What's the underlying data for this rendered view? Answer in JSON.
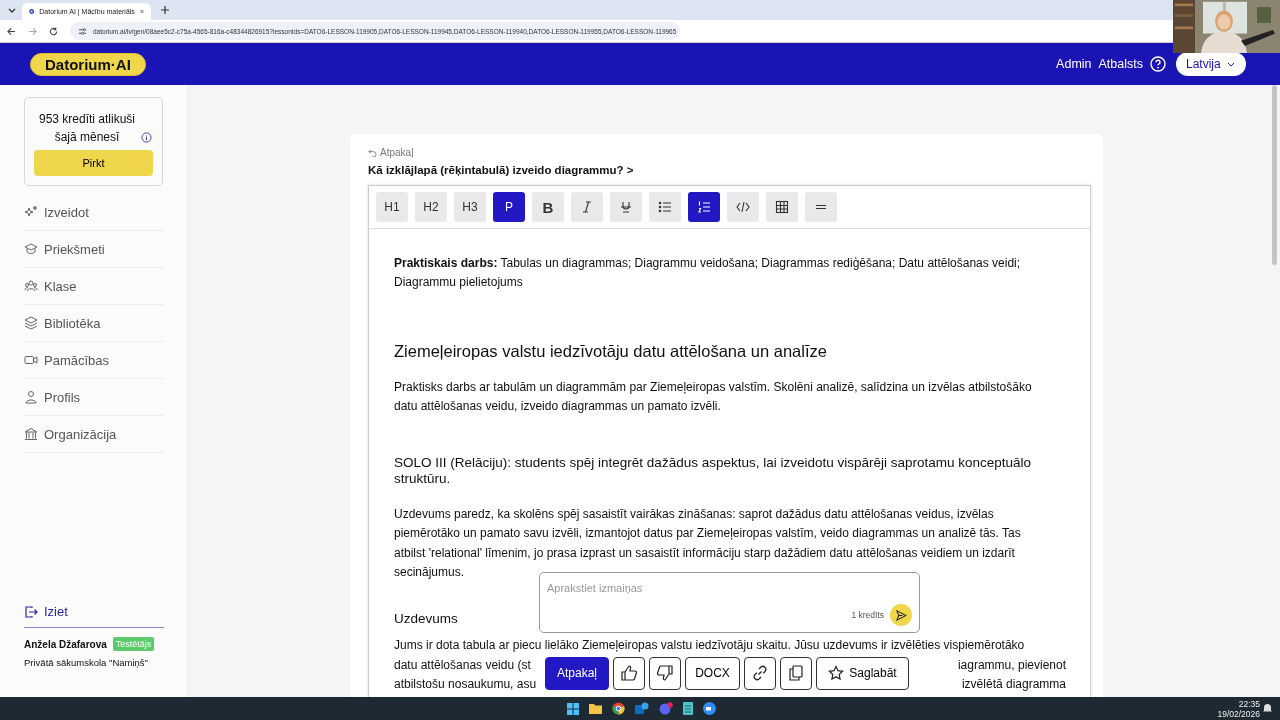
{
  "browser": {
    "tab_title": "Datorium AI | Mācību materiāls",
    "url": "datorium.ai/lv/gen/08aee5c2-c75a-4565-816a-c48344826915?lessonIds=DATO6-LESSON-119905,DATO6-LESSON-119945,DATO6-LESSON-119940,DATO6-LESSON-119955,DATO6-LESSON-119965"
  },
  "header": {
    "logo": "Datorium·AI",
    "links": [
      "Admin",
      "Atbalsts"
    ],
    "language": "Latvija"
  },
  "sidebar": {
    "credits": "953 kredīti atlikuši šajā mēnesī",
    "buy_button": "Pirkt",
    "items": [
      {
        "kind": "create",
        "label": "Izveidot"
      },
      {
        "kind": "subjects",
        "label": "Priekšmeti"
      },
      {
        "kind": "class",
        "label": "Klase"
      },
      {
        "kind": "library",
        "label": "Bibliotēka"
      },
      {
        "kind": "tutorials",
        "label": "Pamācības"
      },
      {
        "kind": "profile",
        "label": "Profils"
      },
      {
        "kind": "organization",
        "label": "Organizācija"
      }
    ],
    "logout": "Iziet",
    "user": {
      "name": "Anžela Džafarova",
      "badge": "Testētājs",
      "school": "Privātā sākumskola \"Namiņš\""
    }
  },
  "editor": {
    "back": "Atpakaļ",
    "breadcrumb": "Kā izklājlapā (rēķintabulā) izveido diagrammu? >",
    "toolbar": [
      {
        "kind": "text",
        "label": "H1",
        "selected": false
      },
      {
        "kind": "text",
        "label": "H2",
        "selected": false
      },
      {
        "kind": "text",
        "label": "H3",
        "selected": false
      },
      {
        "kind": "text",
        "label": "P",
        "selected": true
      },
      {
        "kind": "bold",
        "label": "B",
        "selected": false
      },
      {
        "kind": "italic",
        "selected": false
      },
      {
        "kind": "strike",
        "selected": false
      },
      {
        "kind": "bullets",
        "selected": false
      },
      {
        "kind": "numbers",
        "selected": true
      },
      {
        "kind": "code",
        "selected": false
      },
      {
        "kind": "table",
        "selected": false
      },
      {
        "kind": "rule",
        "selected": false
      }
    ],
    "blocks": [
      {
        "kind": "p",
        "text": "**Praktiskais darbs:** Tabulas un diagrammas; Diagrammu veidošana; Diagrammas rediģēšana; Datu attēlošanas veidi; Diagrammu pielietojums"
      },
      {
        "kind": "h2",
        "text": "Ziemeļeiropas valstu iedzīvotāju datu attēlošana un analīze"
      },
      {
        "kind": "p",
        "text": "Praktisks darbs ar tabulām un diagrammām par Ziemeļeiropas valstīm. Skolēni analizē, salīdzina un izvēlas atbilstošāko datu attēlošanas veidu, izveido diagrammas un pamato izvēli."
      },
      {
        "kind": "h3",
        "text": "SOLO III (Relāciju): students spēj integrēt dažādus aspektus, lai izveidotu vispārēji saprotamu konceptuālo struktūru."
      },
      {
        "kind": "p",
        "text": "Uzdevums paredz, ka skolēns spēj sasaistīt vairākas zināšanas: saprot dažādus datu attēlošanas veidus, izvēlas piemērotāko un pamato savu izvēli, izmantojot datus par Ziemeļeiropas valstīm, veido diagrammas un analizē tās. Tas atbilst 'relational' līmenim, jo prasa izprast un sasaistīt informāciju starp dažādiem datu attēlošanas veidiem un izdarīt secinājumus."
      },
      {
        "kind": "h4",
        "text": "Uzdevums"
      },
      {
        "kind": "split",
        "lines": [
          {
            "left": "Jums ir dota tabula ar piecu lielāko Ziemeļeiropas valstu iedzīvotāju skaitu. Jūsu uzdevums ir izvēlēties vispiemērotāko"
          },
          {
            "left": "datu attēlošanas veidu (st",
            "right": "iagrammu, pievienot"
          },
          {
            "left": "atbilstošu nosaukumu, asu",
            "right": "izvēlētā diagramma"
          }
        ]
      }
    ],
    "prompt": {
      "placeholder": "Aprakstiet izmaiņas",
      "cost": "1 kredīts"
    },
    "actions": [
      {
        "kind": "primary",
        "label": "Atpakaļ"
      },
      {
        "kind": "like"
      },
      {
        "kind": "dislike"
      },
      {
        "kind": "text",
        "label": "DOCX"
      },
      {
        "kind": "link"
      },
      {
        "kind": "copy"
      },
      {
        "kind": "save",
        "label": "Saglabāt"
      }
    ]
  },
  "taskbar": {
    "time": "22:35",
    "date": "19/02/2026"
  }
}
